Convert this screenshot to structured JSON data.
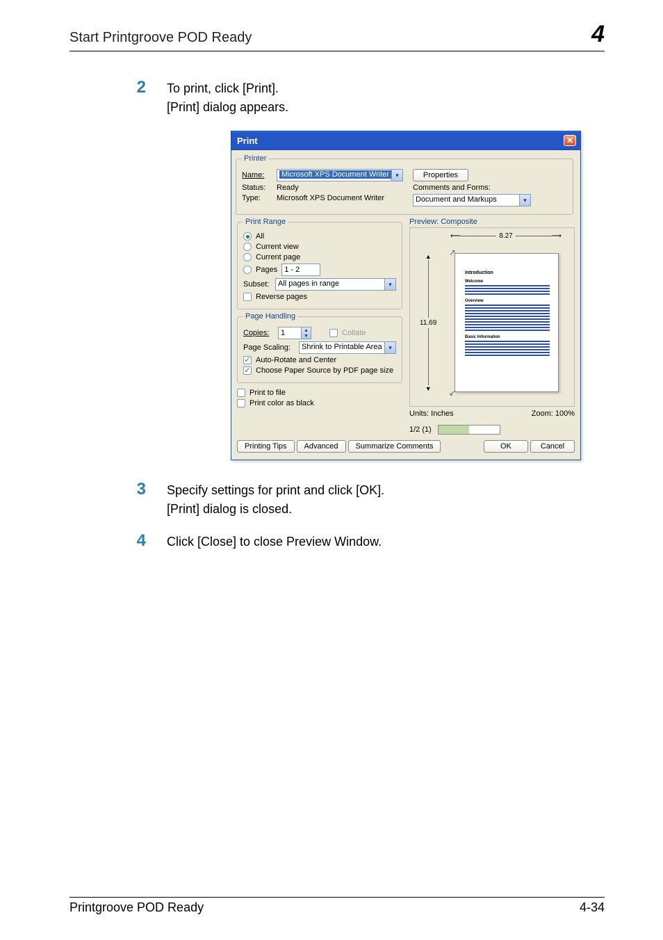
{
  "header": {
    "title": "Start Printgroove POD Ready",
    "chapter": "4"
  },
  "steps": {
    "s2": {
      "num": "2",
      "line1": "To print, click [Print].",
      "line2": "[Print] dialog appears."
    },
    "s3": {
      "num": "3",
      "line1": "Specify settings for print and click [OK].",
      "line2": "[Print] dialog is closed."
    },
    "s4": {
      "num": "4",
      "line1": "Click [Close] to close Preview Window."
    }
  },
  "dialog": {
    "title": "Print",
    "printer": {
      "legend": "Printer",
      "name_label": "Name:",
      "name_value": "Microsoft XPS Document Writer",
      "status_label": "Status:",
      "status_value": "Ready",
      "type_label": "Type:",
      "type_value": "Microsoft XPS Document Writer",
      "properties": "Properties",
      "comments_label": "Comments and Forms:",
      "comments_value": "Document and Markups"
    },
    "range": {
      "legend": "Print Range",
      "all": "All",
      "current_view": "Current view",
      "current_page": "Current page",
      "pages": "Pages",
      "pages_value": "1 - 2",
      "subset_label": "Subset:",
      "subset_value": "All pages in range",
      "reverse": "Reverse pages"
    },
    "handling": {
      "legend": "Page Handling",
      "copies_label": "Copies:",
      "copies_value": "1",
      "collate": "Collate",
      "scaling_label": "Page Scaling:",
      "scaling_value": "Shrink to Printable Area",
      "auto_rotate": "Auto-Rotate and Center",
      "choose_source": "Choose Paper Source by PDF page size"
    },
    "bottom_left": {
      "print_to_file": "Print to file",
      "print_color_black": "Print color as black"
    },
    "preview": {
      "title": "Preview: Composite",
      "width": "8.27",
      "height": "11.69",
      "units": "Units: Inches",
      "zoom": "Zoom: 100%",
      "page_count": "1/2 (1)",
      "thumb": {
        "h1": "Introduction",
        "h2": "Welcome",
        "h3": "Overview",
        "h4": "Basic Information"
      }
    },
    "buttons": {
      "tips": "Printing Tips",
      "advanced": "Advanced",
      "summarize": "Summarize Comments",
      "ok": "OK",
      "cancel": "Cancel"
    }
  },
  "footer": {
    "product": "Printgroove POD Ready",
    "page": "4-34"
  }
}
